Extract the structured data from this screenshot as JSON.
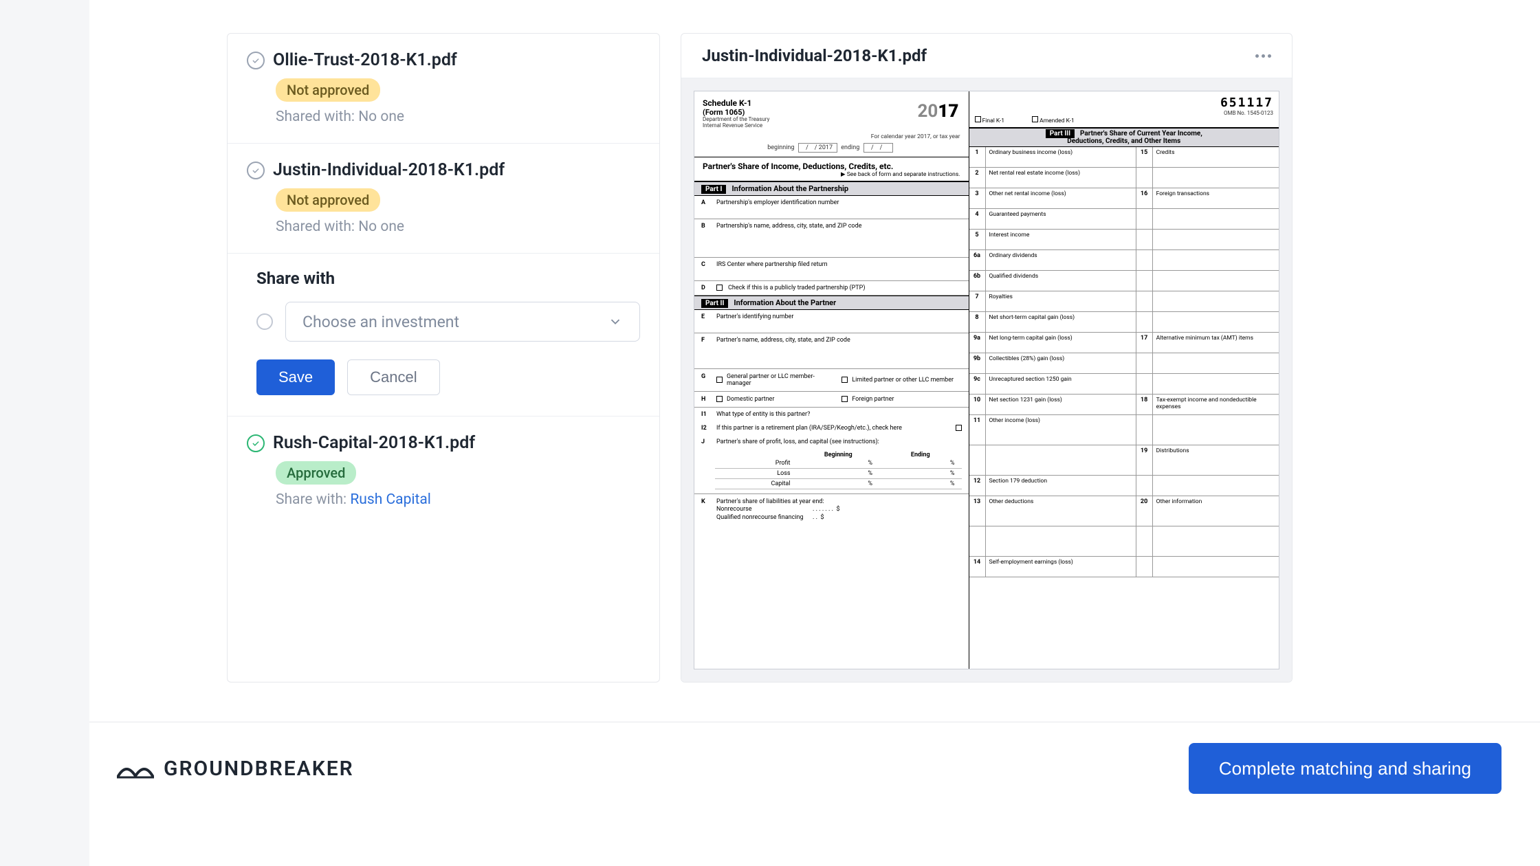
{
  "files": [
    {
      "name": "Ollie-Trust-2018-K1.pdf",
      "status": "Not approved",
      "shared_prefix": "Shared with: ",
      "shared_value": "No one",
      "approved": false
    },
    {
      "name": "Justin-Individual-2018-K1.pdf",
      "status": "Not approved",
      "shared_prefix": "Shared with: ",
      "shared_value": "No one",
      "approved": false
    },
    {
      "name": "Rush-Capital-2018-K1.pdf",
      "status": "Approved",
      "shared_prefix": "Share with: ",
      "shared_value": "Rush Capital",
      "approved": true,
      "shared_link": true
    }
  ],
  "share_panel": {
    "title": "Share with",
    "placeholder": "Choose an investment",
    "save": "Save",
    "cancel": "Cancel"
  },
  "preview": {
    "title": "Justin-Individual-2018-K1.pdf",
    "ocr": "651117",
    "omb": "OMB No. 1545-0123",
    "schedule": "Schedule K-1",
    "form_no": "(Form 1065)",
    "dept1": "Department of the Treasury",
    "dept2": "Internal Revenue Service",
    "year_gray": "20",
    "year_bold": "17",
    "cal": "For calendar year 2017, or tax year",
    "beginning": "beginning",
    "ending": "ending",
    "yslot": "2017",
    "main_title": "Partner's Share of Income, Deductions, Credits, etc.",
    "main_sub": "▶ See back of form and separate instructions.",
    "final_k1": "Final K-1",
    "amended_k1": "Amended K-1",
    "part1": "Information About the Partnership",
    "part2": "Information About the Partner",
    "part3_a": "Partner's Share of Current Year Income,",
    "part3_b": "Deductions, Credits, and Other Items",
    "fA": "Partnership's employer identification number",
    "fB": "Partnership's name, address, city, state, and ZIP code",
    "fC": "IRS Center where partnership filed return",
    "fD": "Check if this is a publicly traded partnership (PTP)",
    "fE": "Partner's identifying number",
    "fF": "Partner's name, address, city, state, and ZIP code",
    "fG1": "General partner or LLC member-manager",
    "fG2": "Limited partner or other LLC member",
    "fH1": "Domestic partner",
    "fH2": "Foreign partner",
    "fI1": "What type of entity is this partner?",
    "fI2": "If this partner is a retirement plan (IRA/SEP/Keogh/etc.), check here",
    "fJ": "Partner's share of profit, loss, and capital (see instructions):",
    "beg": "Beginning",
    "end": "Ending",
    "profit": "Profit",
    "loss": "Loss",
    "capital": "Capital",
    "pct": "%",
    "fK": "Partner's share of liabilities at year end:",
    "nonrecourse": "Nonrecourse",
    "qnf": "Qualified nonrecourse financing",
    "dollar": "$",
    "r1": "Ordinary business income (loss)",
    "r2": "Net rental real estate income (loss)",
    "r3": "Other net rental income (loss)",
    "r4": "Guaranteed payments",
    "r5": "Interest income",
    "r6a": "Ordinary dividends",
    "r6b": "Qualified dividends",
    "r7": "Royalties",
    "r8": "Net short-term capital gain (loss)",
    "r9a": "Net long-term capital gain (loss)",
    "r9b": "Collectibles (28%) gain (loss)",
    "r9c": "Unrecaptured section 1250 gain",
    "r10": "Net section 1231 gain (loss)",
    "r11": "Other income (loss)",
    "r12": "Section 179 deduction",
    "r13": "Other deductions",
    "r14": "Self-employment earnings (loss)",
    "r15": "Credits",
    "r16": "Foreign transactions",
    "r17": "Alternative minimum tax (AMT) items",
    "r18": "Tax-exempt income and nondeductible expenses",
    "r19": "Distributions",
    "r20": "Other information"
  },
  "footer": {
    "brand": "GROUNDBREAKER",
    "cta": "Complete matching and sharing"
  }
}
